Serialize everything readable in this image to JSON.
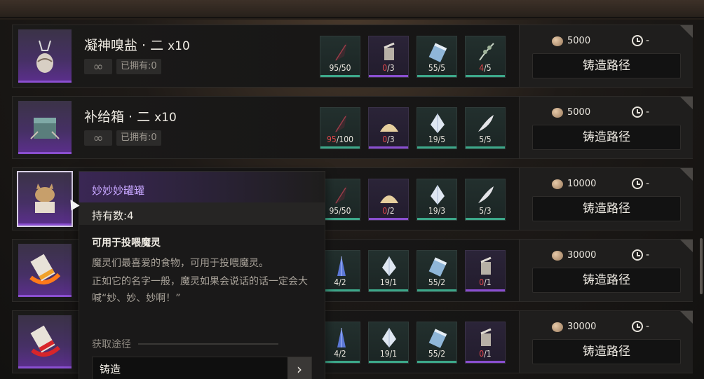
{
  "coin_color": "#cfae8c",
  "rows": [
    {
      "title": "凝神嗅盐 · 二",
      "qty": "x10",
      "infinite_icon": "infinity-icon",
      "owned": "已拥有:0",
      "item_icon": "smelling-salt-icon",
      "materials": [
        {
          "icon": "dark-feather-icon",
          "have": "95",
          "need": "/50",
          "short": false,
          "color": "green"
        },
        {
          "icon": "powder-jar-icon",
          "have": "0",
          "need": "/3",
          "short": true,
          "color": "purple"
        },
        {
          "icon": "crystal-vial-icon",
          "have": "55",
          "need": "/5",
          "short": false,
          "color": "green"
        },
        {
          "icon": "herb-sprig-icon",
          "have": "4",
          "need": "/5",
          "short": true,
          "color": "green"
        }
      ],
      "cost": "5000",
      "timer": "-",
      "forge_label": "铸造路径"
    },
    {
      "title": "补给箱 · 二",
      "qty": "x10",
      "infinite_icon": "infinity-icon",
      "owned": "已拥有:0",
      "item_icon": "supply-crate-icon",
      "materials": [
        {
          "icon": "dark-feather-icon",
          "have": "95",
          "need": "/100",
          "short": true,
          "color": "green"
        },
        {
          "icon": "sand-pile-icon",
          "have": "0",
          "need": "/3",
          "short": true,
          "color": "purple"
        },
        {
          "icon": "crystal-shard-icon",
          "have": "19",
          "need": "/5",
          "short": false,
          "color": "green"
        },
        {
          "icon": "silver-leaf-icon",
          "have": "5",
          "need": "/5",
          "short": false,
          "color": "green"
        }
      ],
      "cost": "5000",
      "timer": "-",
      "forge_label": "铸造路径"
    },
    {
      "title": "妙妙妙罐罐",
      "qty": "",
      "infinite_icon": "",
      "owned": "",
      "item_icon": "cat-food-can-icon",
      "materials": [
        {
          "icon": "dark-feather-icon",
          "have": "95",
          "need": "/50",
          "short": false,
          "color": "green"
        },
        {
          "icon": "sand-pile-icon",
          "have": "0",
          "need": "/2",
          "short": true,
          "color": "purple"
        },
        {
          "icon": "crystal-shard-icon",
          "have": "19",
          "need": "/3",
          "short": false,
          "color": "green"
        },
        {
          "icon": "silver-leaf-icon",
          "have": "5",
          "need": "/3",
          "short": false,
          "color": "green"
        }
      ],
      "cost": "10000",
      "timer": "-",
      "forge_label": "铸造路径"
    },
    {
      "title": "",
      "qty": "",
      "infinite_icon": "",
      "owned": "",
      "item_icon": "paint-tube-orange-icon",
      "materials": [
        {
          "icon": "blue-crystal-icon",
          "have": "4",
          "need": "/2",
          "short": false,
          "color": "green"
        },
        {
          "icon": "crystal-shard-icon",
          "have": "19",
          "need": "/1",
          "short": false,
          "color": "green"
        },
        {
          "icon": "crystal-vial-icon",
          "have": "55",
          "need": "/2",
          "short": false,
          "color": "green"
        },
        {
          "icon": "powder-jar-icon",
          "have": "0",
          "need": "/1",
          "short": true,
          "color": "purple"
        }
      ],
      "cost": "30000",
      "timer": "-",
      "forge_label": "铸造路径"
    },
    {
      "title": "",
      "qty": "",
      "infinite_icon": "",
      "owned": "",
      "item_icon": "paint-tube-red-icon",
      "materials": [
        {
          "icon": "blue-crystal-icon",
          "have": "4",
          "need": "/2",
          "short": false,
          "color": "green"
        },
        {
          "icon": "crystal-shard-icon",
          "have": "19",
          "need": "/1",
          "short": false,
          "color": "green"
        },
        {
          "icon": "crystal-vial-icon",
          "have": "55",
          "need": "/2",
          "short": false,
          "color": "green"
        },
        {
          "icon": "powder-jar-icon",
          "have": "0",
          "need": "/1",
          "short": true,
          "color": "purple"
        }
      ],
      "cost": "30000",
      "timer": "-",
      "forge_label": "铸造路径"
    }
  ],
  "tooltip": {
    "name": "妙妙妙罐罐",
    "count": "持有数:4",
    "subtitle": "可用于投喂魔灵",
    "desc_1": "魔灵们最喜爱的食物，可用于投喂魔灵。",
    "desc_2": "正如它的名字一般，魔灵如果会说话的话一定会大喊“妙、妙、妙啊！”",
    "source_label": "获取途径",
    "route_label": "铸造",
    "route_arrow": "›"
  }
}
